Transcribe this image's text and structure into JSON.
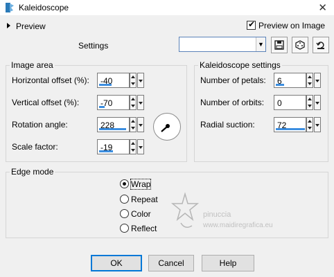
{
  "window": {
    "title": "Kaleidoscope",
    "close_glyph": "✕"
  },
  "header": {
    "preview_label": "Preview",
    "preview_on_image_label": "Preview on Image",
    "preview_on_image_checked": true,
    "settings_label": "Settings",
    "settings_combo_value": ""
  },
  "image_area": {
    "title": "Image area",
    "horizontal_offset": {
      "label": "Horizontal offset (%):",
      "value": "-40"
    },
    "vertical_offset": {
      "label": "Vertical offset (%):",
      "value": "-70"
    },
    "rotation_angle": {
      "label": "Rotation angle:",
      "value": "228"
    },
    "scale_factor": {
      "label": "Scale factor:",
      "value": "-19"
    }
  },
  "kaleidoscope_settings": {
    "title": "Kaleidoscope settings",
    "number_of_petals": {
      "label": "Number of petals:",
      "value": "6"
    },
    "number_of_orbits": {
      "label": "Number of orbits:",
      "value": "0"
    },
    "radial_suction": {
      "label": "Radial suction:",
      "value": "72"
    }
  },
  "edge_mode": {
    "title": "Edge mode",
    "options": [
      "Wrap",
      "Repeat",
      "Color",
      "Reflect"
    ],
    "selected": "Wrap"
  },
  "watermark": {
    "line1": "pinuccia",
    "line2": "www.maidiregrafica.eu"
  },
  "buttons": {
    "ok": "OK",
    "cancel": "Cancel",
    "help": "Help"
  },
  "colors": {
    "accent": "#0078d7",
    "slider_bar": "#3c8ee0",
    "background": "#f0f0f0"
  }
}
